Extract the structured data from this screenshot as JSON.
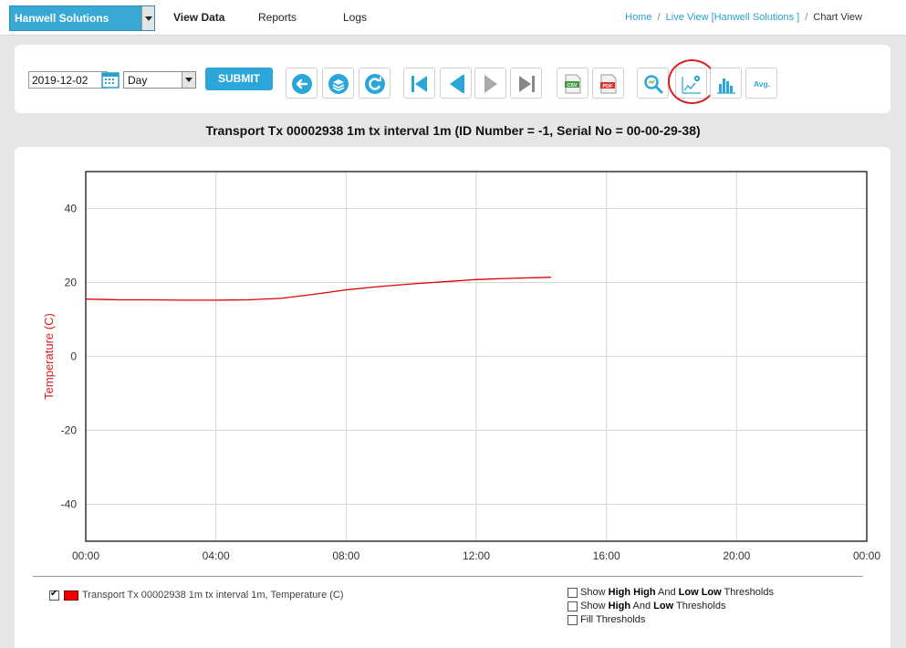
{
  "topbar": {
    "org_select": "Hanwell Solutions",
    "nav": [
      "View Data",
      "Reports",
      "Logs"
    ],
    "breadcrumb": {
      "home": "Home",
      "sep": "/",
      "live": "Live View [Hanwell Solutions ]",
      "current": "Chart View"
    }
  },
  "toolbar": {
    "date_value": "2019-12-02",
    "range_value": "Day",
    "submit_label": "SUBMIT",
    "buttons": [
      "back-icon",
      "layers-icon",
      "refresh-icon",
      "first-icon",
      "prev-icon",
      "next-icon",
      "last-icon",
      "csv-icon",
      "pdf-icon",
      "zoom-icon",
      "chart-settings-icon",
      "histogram-icon",
      "avg-icon"
    ],
    "csv_label": "CSV",
    "pdf_label": "PDF",
    "avg_label": "Avg."
  },
  "chart_title": "Transport Tx 00002938 1m tx interval 1m (ID Number = -1, Serial No = 00-00-29-38)",
  "chart_data": {
    "type": "line",
    "ylabel": "Temperature (C)",
    "xlabel": "",
    "x_ticks": [
      "00:00",
      "04:00",
      "08:00",
      "12:00",
      "16:00",
      "20:00",
      "00:00"
    ],
    "y_ticks": [
      40,
      20,
      0,
      -20,
      -40
    ],
    "ylim": [
      -50,
      50
    ],
    "xlim_hours": [
      0,
      24
    ],
    "grid": true,
    "series": [
      {
        "name": "Transport Tx 00002938 1m tx interval 1m, Temperature (C)",
        "color": "#e00000",
        "x": [
          0,
          1,
          2,
          3,
          4,
          5,
          6,
          7,
          8,
          9,
          10,
          11,
          12,
          13,
          14.3
        ],
        "y": [
          15.5,
          15.3,
          15.3,
          15.2,
          15.2,
          15.3,
          15.7,
          16.8,
          18.0,
          18.9,
          19.6,
          20.2,
          20.8,
          21.1,
          21.4
        ]
      }
    ]
  },
  "legend": {
    "series_label": "Transport Tx 00002938 1m tx interval 1m, Temperature (C)",
    "thresholds": [
      {
        "pre": "Show ",
        "b1": "High High",
        "mid": " And ",
        "b2": "Low Low",
        "post": " Thresholds"
      },
      {
        "pre": "Show ",
        "b1": "High",
        "mid": " And ",
        "b2": "Low",
        "post": " Thresholds"
      },
      {
        "pre": "Fill Thresholds",
        "b1": "",
        "mid": "",
        "b2": "",
        "post": ""
      }
    ]
  }
}
